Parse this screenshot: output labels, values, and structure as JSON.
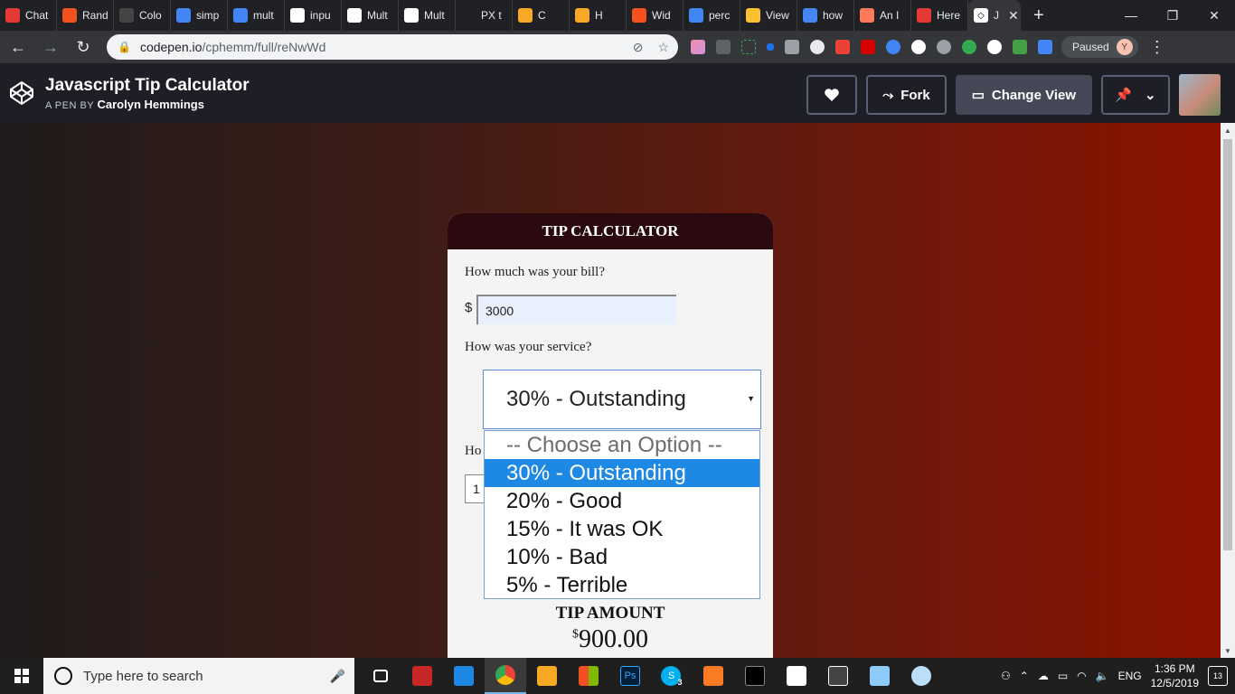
{
  "browser": {
    "tabs": [
      {
        "label": "Chat",
        "color": "#e53935"
      },
      {
        "label": "Rand",
        "color": "#f4511e"
      },
      {
        "label": "Colo",
        "color": "#444444"
      },
      {
        "label": "simp",
        "color": "#4285f4"
      },
      {
        "label": "mult",
        "color": "#4285f4"
      },
      {
        "label": "inpu",
        "color": "#ffffff"
      },
      {
        "label": "Mult",
        "color": "#ffffff"
      },
      {
        "label": "Mult",
        "color": "#ffffff"
      },
      {
        "label": "PX t",
        "color": "#202124"
      },
      {
        "label": "C",
        "color": "#f9a825"
      },
      {
        "label": "H",
        "color": "#f9a825"
      },
      {
        "label": "Wid",
        "color": "#f4511e"
      },
      {
        "label": "perc",
        "color": "#4285f4"
      },
      {
        "label": "View",
        "color": "#fbc02d"
      },
      {
        "label": "how",
        "color": "#4285f4"
      },
      {
        "label": "An I",
        "color": "#ff7a59"
      },
      {
        "label": "Here",
        "color": "#e53935"
      }
    ],
    "active_tab": {
      "label": "J",
      "close": "✕"
    },
    "new_tab": "+",
    "window_controls": {
      "minimize": "—",
      "restore": "❐",
      "close": "✕"
    },
    "address": {
      "host": "codepen.io",
      "path": "/cphemm/full/reNwWd"
    },
    "profile": {
      "status": "Paused",
      "initial": "Y"
    }
  },
  "codepen": {
    "title": "Javascript Tip Calculator",
    "by_prefix": "A PEN BY",
    "author": "Carolyn Hemmings",
    "fork_label": "Fork",
    "change_view_label": "Change View"
  },
  "calculator": {
    "header": "TIP CALCULATOR",
    "bill_question": "How much was your bill?",
    "currency": "$",
    "bill_value": "3000",
    "service_question": "How was your service?",
    "service_selected": "30% - Outstanding",
    "people_question_partial": "Ho",
    "people_value_partial": "1",
    "options": [
      "-- Choose an Option --",
      "30% - Outstanding",
      "20% - Good",
      "15% - It was OK",
      "10% - Bad",
      "5% - Terrible"
    ],
    "highlighted_option_index": 1,
    "tip_label": "TIP AMOUNT",
    "tip_currency": "$",
    "tip_value": "900.00"
  },
  "taskbar": {
    "search_placeholder": "Type here to search",
    "language": "ENG",
    "time": "1:36 PM",
    "date": "12/5/2019",
    "notification_count": "13",
    "skype_badge": "3"
  }
}
